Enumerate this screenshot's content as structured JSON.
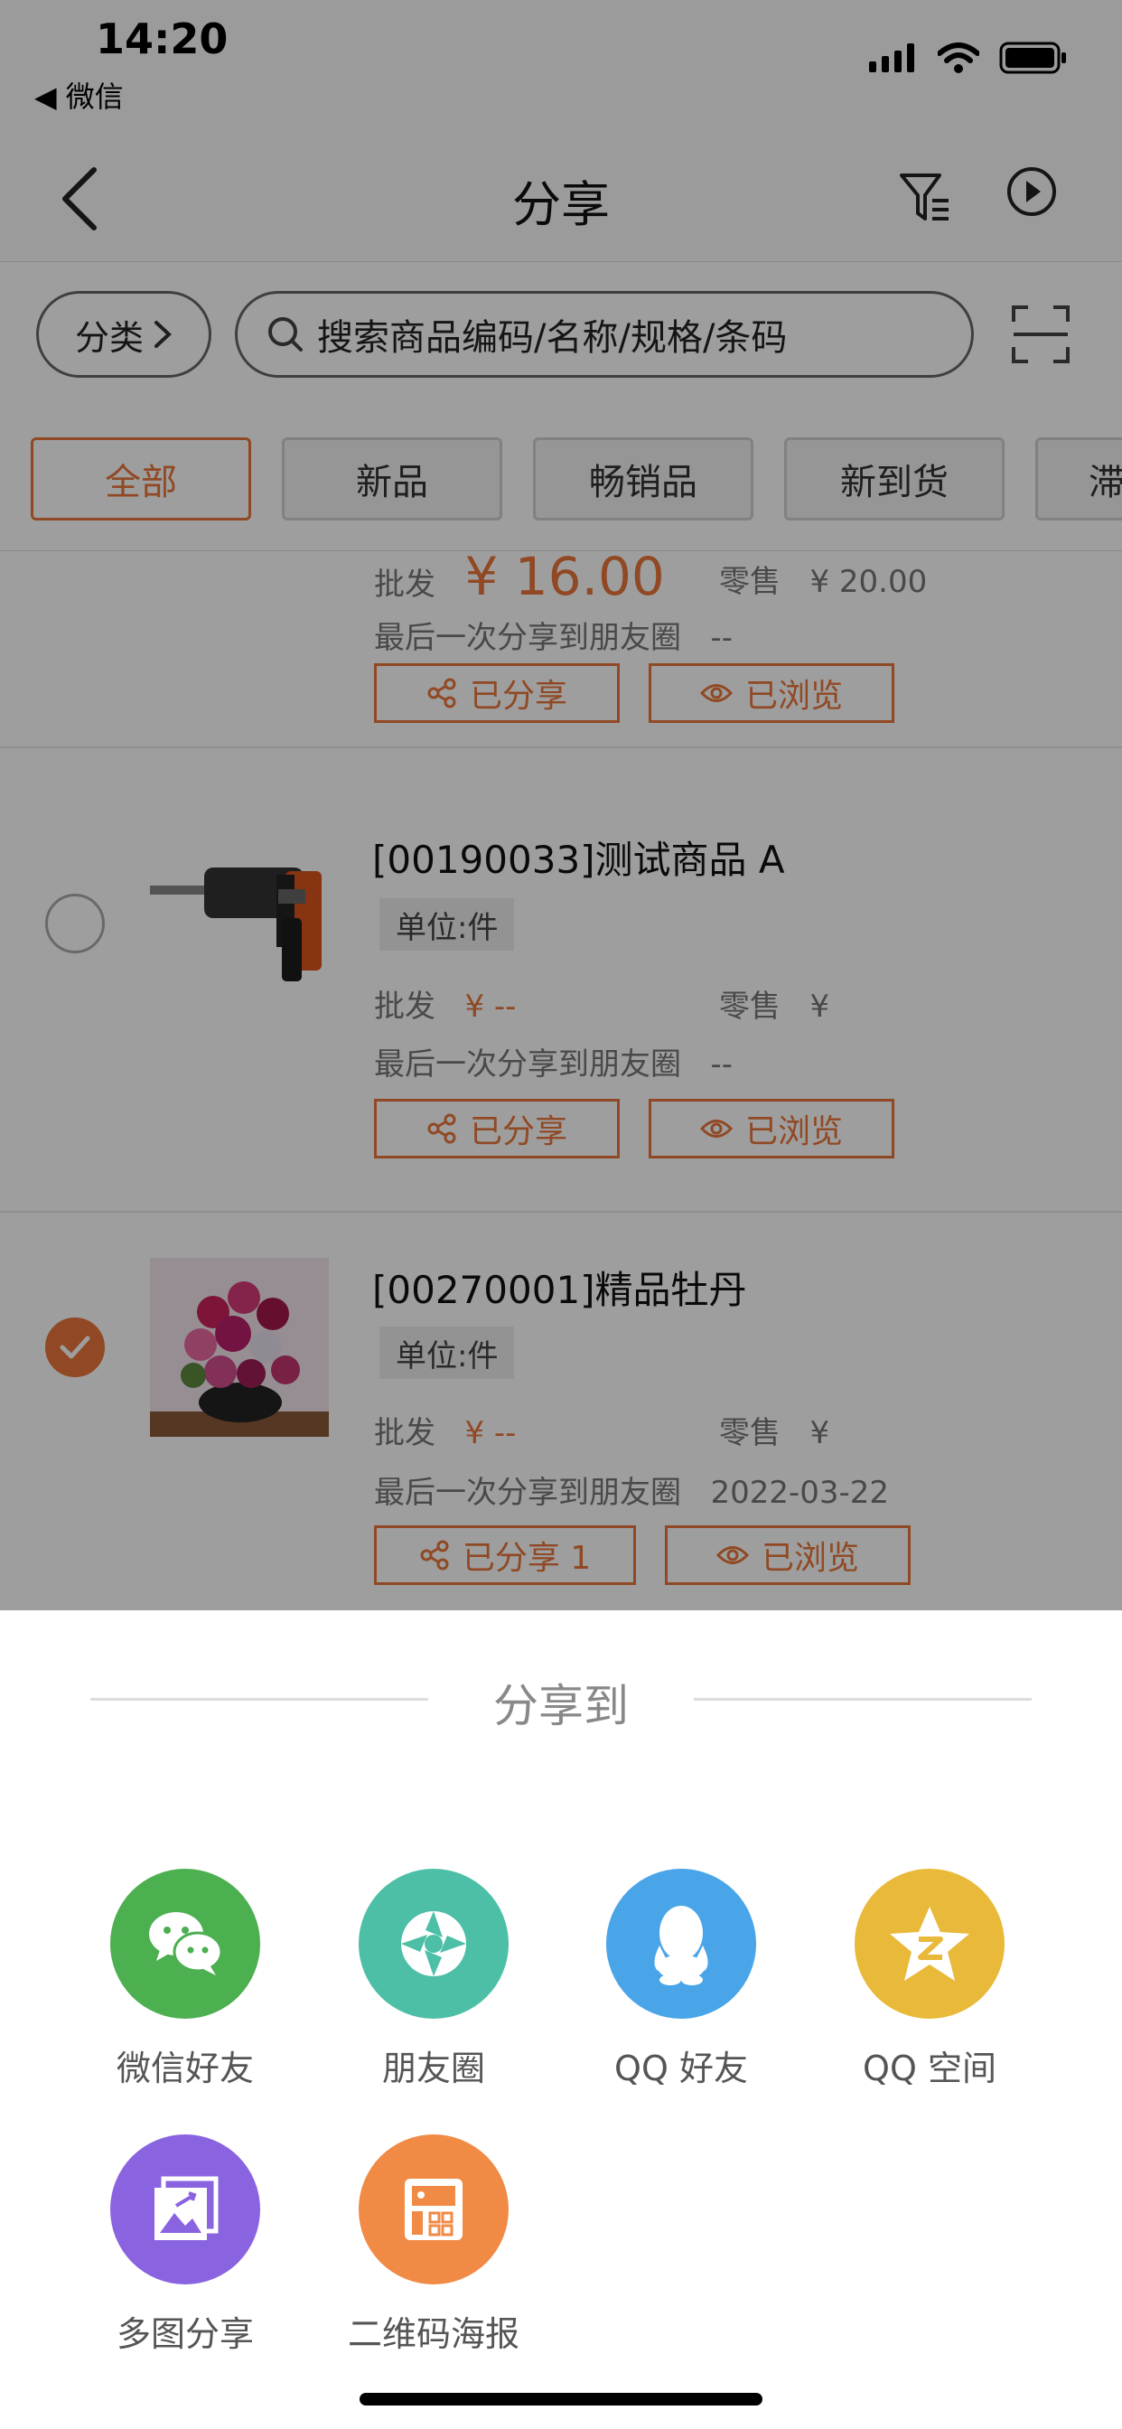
{
  "status_bar": {
    "time": "14:20",
    "back_app": "◀ 微信"
  },
  "nav": {
    "title": "分享"
  },
  "search": {
    "category_label": "分类",
    "placeholder": "搜索商品编码/名称/规格/条码"
  },
  "tabs": [
    "全部",
    "新品",
    "畅销品",
    "新到货",
    "滞"
  ],
  "items": [
    {
      "name": "",
      "wholesale_label": "批发",
      "wholesale_price": "¥ 16.00",
      "retail_label": "零售",
      "retail_price": "¥ 20.00",
      "last_share_label": "最后一次分享到朋友圈",
      "last_share_value": "--",
      "shared_label": "已分享",
      "viewed_label": "已浏览",
      "checked": false
    },
    {
      "name": "[00190033]测试商品 A",
      "unit": "单位:件",
      "wholesale_label": "批发",
      "wholesale_price": "¥ --",
      "retail_label": "零售",
      "retail_price": "¥",
      "last_share_label": "最后一次分享到朋友圈",
      "last_share_value": "--",
      "shared_label": "已分享",
      "viewed_label": "已浏览",
      "checked": false
    },
    {
      "name": "[00270001]精品牡丹",
      "unit": "单位:件",
      "wholesale_label": "批发",
      "wholesale_price": "¥ --",
      "retail_label": "零售",
      "retail_price": "¥",
      "last_share_label": "最后一次分享到朋友圈",
      "last_share_value": "2022-03-22",
      "shared_label": "已分享 1",
      "viewed_label": "已浏览",
      "checked": true
    }
  ],
  "share_sheet": {
    "title": "分享到",
    "options": [
      {
        "label": "微信好友",
        "icon": "wechat-icon",
        "color": "#4caf50"
      },
      {
        "label": "朋友圈",
        "icon": "moments-icon",
        "color": "#4cbfa6"
      },
      {
        "label": "QQ 好友",
        "icon": "qq-icon",
        "color": "#4aa5e8"
      },
      {
        "label": "QQ 空间",
        "icon": "qzone-icon",
        "color": "#e9b93a"
      },
      {
        "label": "多图分享",
        "icon": "multi-image-icon",
        "color": "#8a63e0"
      },
      {
        "label": "二维码海报",
        "icon": "qr-poster-icon",
        "color": "#f08a45"
      }
    ]
  },
  "colors": {
    "accent": "#e8773a"
  }
}
